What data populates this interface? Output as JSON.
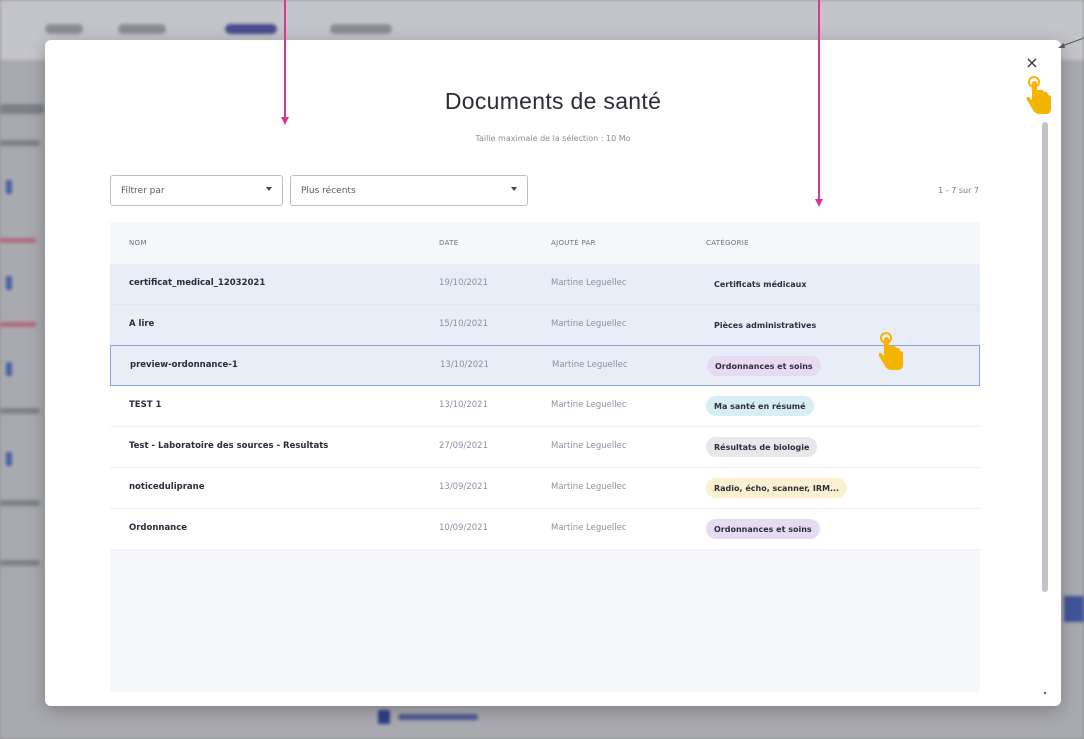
{
  "modal": {
    "title": "Documents de santé",
    "subtitle": "Taille maximale de la sélection : 10 Mo",
    "close_label": "×",
    "filter_placeholder": "Filtrer par",
    "sort_value": "Plus récents",
    "pagination": "1 - 7 sur 7"
  },
  "table": {
    "columns": [
      "NOM",
      "DATE",
      "AJOUTÉ PAR",
      "CATÉGORIE"
    ],
    "rows": [
      {
        "name": "certificat_medical_12032021",
        "date": "19/10/2021",
        "added_by": "Martine Leguellec",
        "category": "Certificats médicaux",
        "badge_color": "#e9edf8"
      },
      {
        "name": "A lire",
        "date": "15/10/2021",
        "added_by": "Martine Leguellec",
        "category": "Pièces administratives",
        "badge_color": "#e9edf8"
      },
      {
        "name": "preview-ordonnance-1",
        "date": "13/10/2021",
        "added_by": "Martine Leguellec",
        "category": "Ordonnances et soins",
        "badge_color": "#e6dbf2"
      },
      {
        "name": "TEST 1",
        "date": "13/10/2021",
        "added_by": "Martine Leguellec",
        "category": "Ma santé en résumé",
        "badge_color": "#d8eef5"
      },
      {
        "name": "Test - Laboratoire des sources - Resultats",
        "date": "27/09/2021",
        "added_by": "Martine Leguellec",
        "category": "Résultats de biologie",
        "badge_color": "#e8e8ea"
      },
      {
        "name": "noticeduliprane",
        "date": "13/09/2021",
        "added_by": "Martine Leguellec",
        "category": "Radio, écho, scanner, IRM...",
        "badge_color": "#fbf0cf"
      },
      {
        "name": "Ordonnance",
        "date": "10/09/2021",
        "added_by": "Martine Leguellec",
        "category": "Ordonnances et soins",
        "badge_color": "#e6dbf2"
      }
    ]
  },
  "colors": {
    "annotation_arrow": "#d63a8f",
    "hand_cursor": "#f5b400",
    "selected_row": "#e9edf8"
  },
  "icons": {
    "close": "close-icon",
    "caret": "chevron-down-icon",
    "cursor": "hand-pointer-icon"
  }
}
